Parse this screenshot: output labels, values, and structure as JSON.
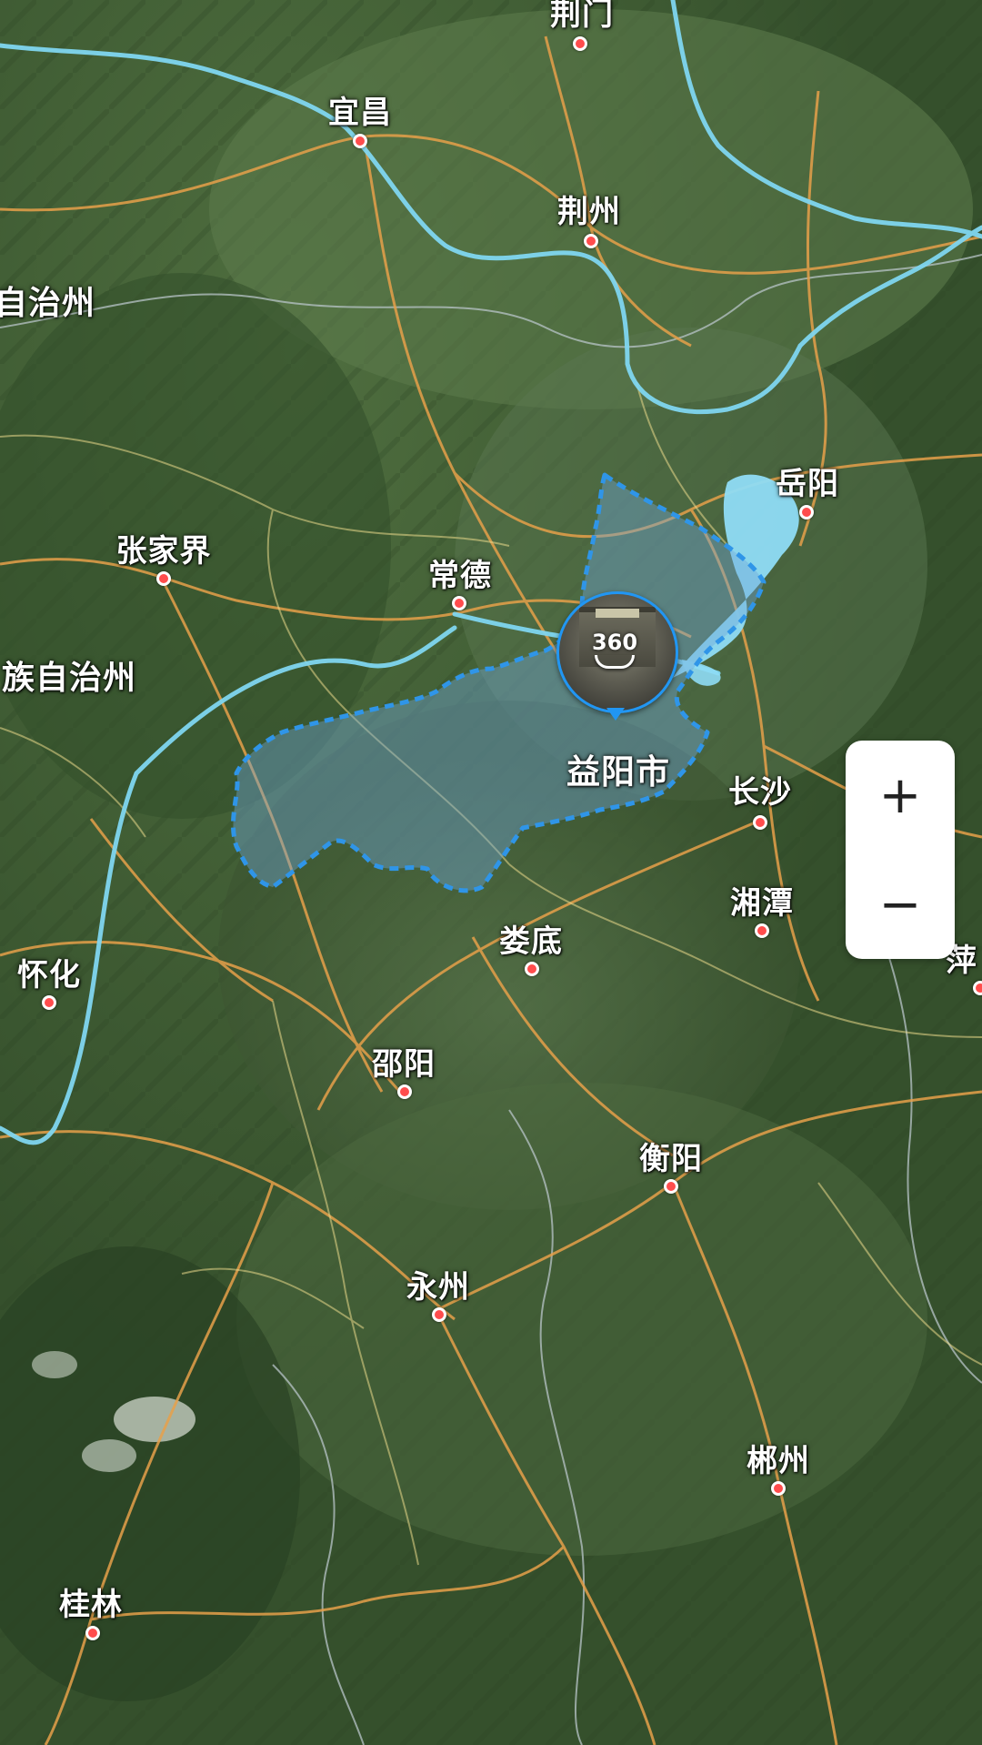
{
  "map": {
    "type": "satellite",
    "colors": {
      "land_dark": "#2f4a27",
      "land_mid": "#4d6b3c",
      "road": "#e6a04a",
      "river": "#7fd6f0",
      "lake": "#8fdcf5",
      "highlight_border": "#2f95e8",
      "highlight_fill": "#6fa8d8",
      "city_dot": "#ff4d4d"
    }
  },
  "cities": [
    {
      "id": "jingmen",
      "name": "荆门",
      "dot": true
    },
    {
      "id": "yichang",
      "name": "宜昌",
      "dot": true
    },
    {
      "id": "jingzhou",
      "name": "荆州",
      "dot": true
    },
    {
      "id": "yueyang",
      "name": "岳阳",
      "dot": true
    },
    {
      "id": "zhangjiajie",
      "name": "张家界",
      "dot": true
    },
    {
      "id": "changde",
      "name": "常德",
      "dot": true
    },
    {
      "id": "changsha",
      "name": "长沙",
      "dot": true
    },
    {
      "id": "xiangtan",
      "name": "湘潭",
      "dot": true
    },
    {
      "id": "loudi",
      "name": "娄底",
      "dot": true
    },
    {
      "id": "huaihua",
      "name": "怀化",
      "dot": true
    },
    {
      "id": "shaoyang",
      "name": "邵阳",
      "dot": true
    },
    {
      "id": "hengyang",
      "name": "衡阳",
      "dot": true
    },
    {
      "id": "yongzhou",
      "name": "永州",
      "dot": true
    },
    {
      "id": "chenzhou",
      "name": "郴州",
      "dot": true
    },
    {
      "id": "guilin",
      "name": "桂林",
      "dot": true
    },
    {
      "id": "pingxiang",
      "name": "萍",
      "dot": true
    }
  ],
  "regions": [
    {
      "id": "zizhizhou-1",
      "name": "自治州"
    },
    {
      "id": "zizhizhou-2",
      "name": "族自治州"
    }
  ],
  "highlight": {
    "name": "益阳市"
  },
  "pano_marker": {
    "label": "360",
    "icon": "panorama-360-icon"
  },
  "zoom": {
    "in_label": "+",
    "out_label": "−"
  }
}
